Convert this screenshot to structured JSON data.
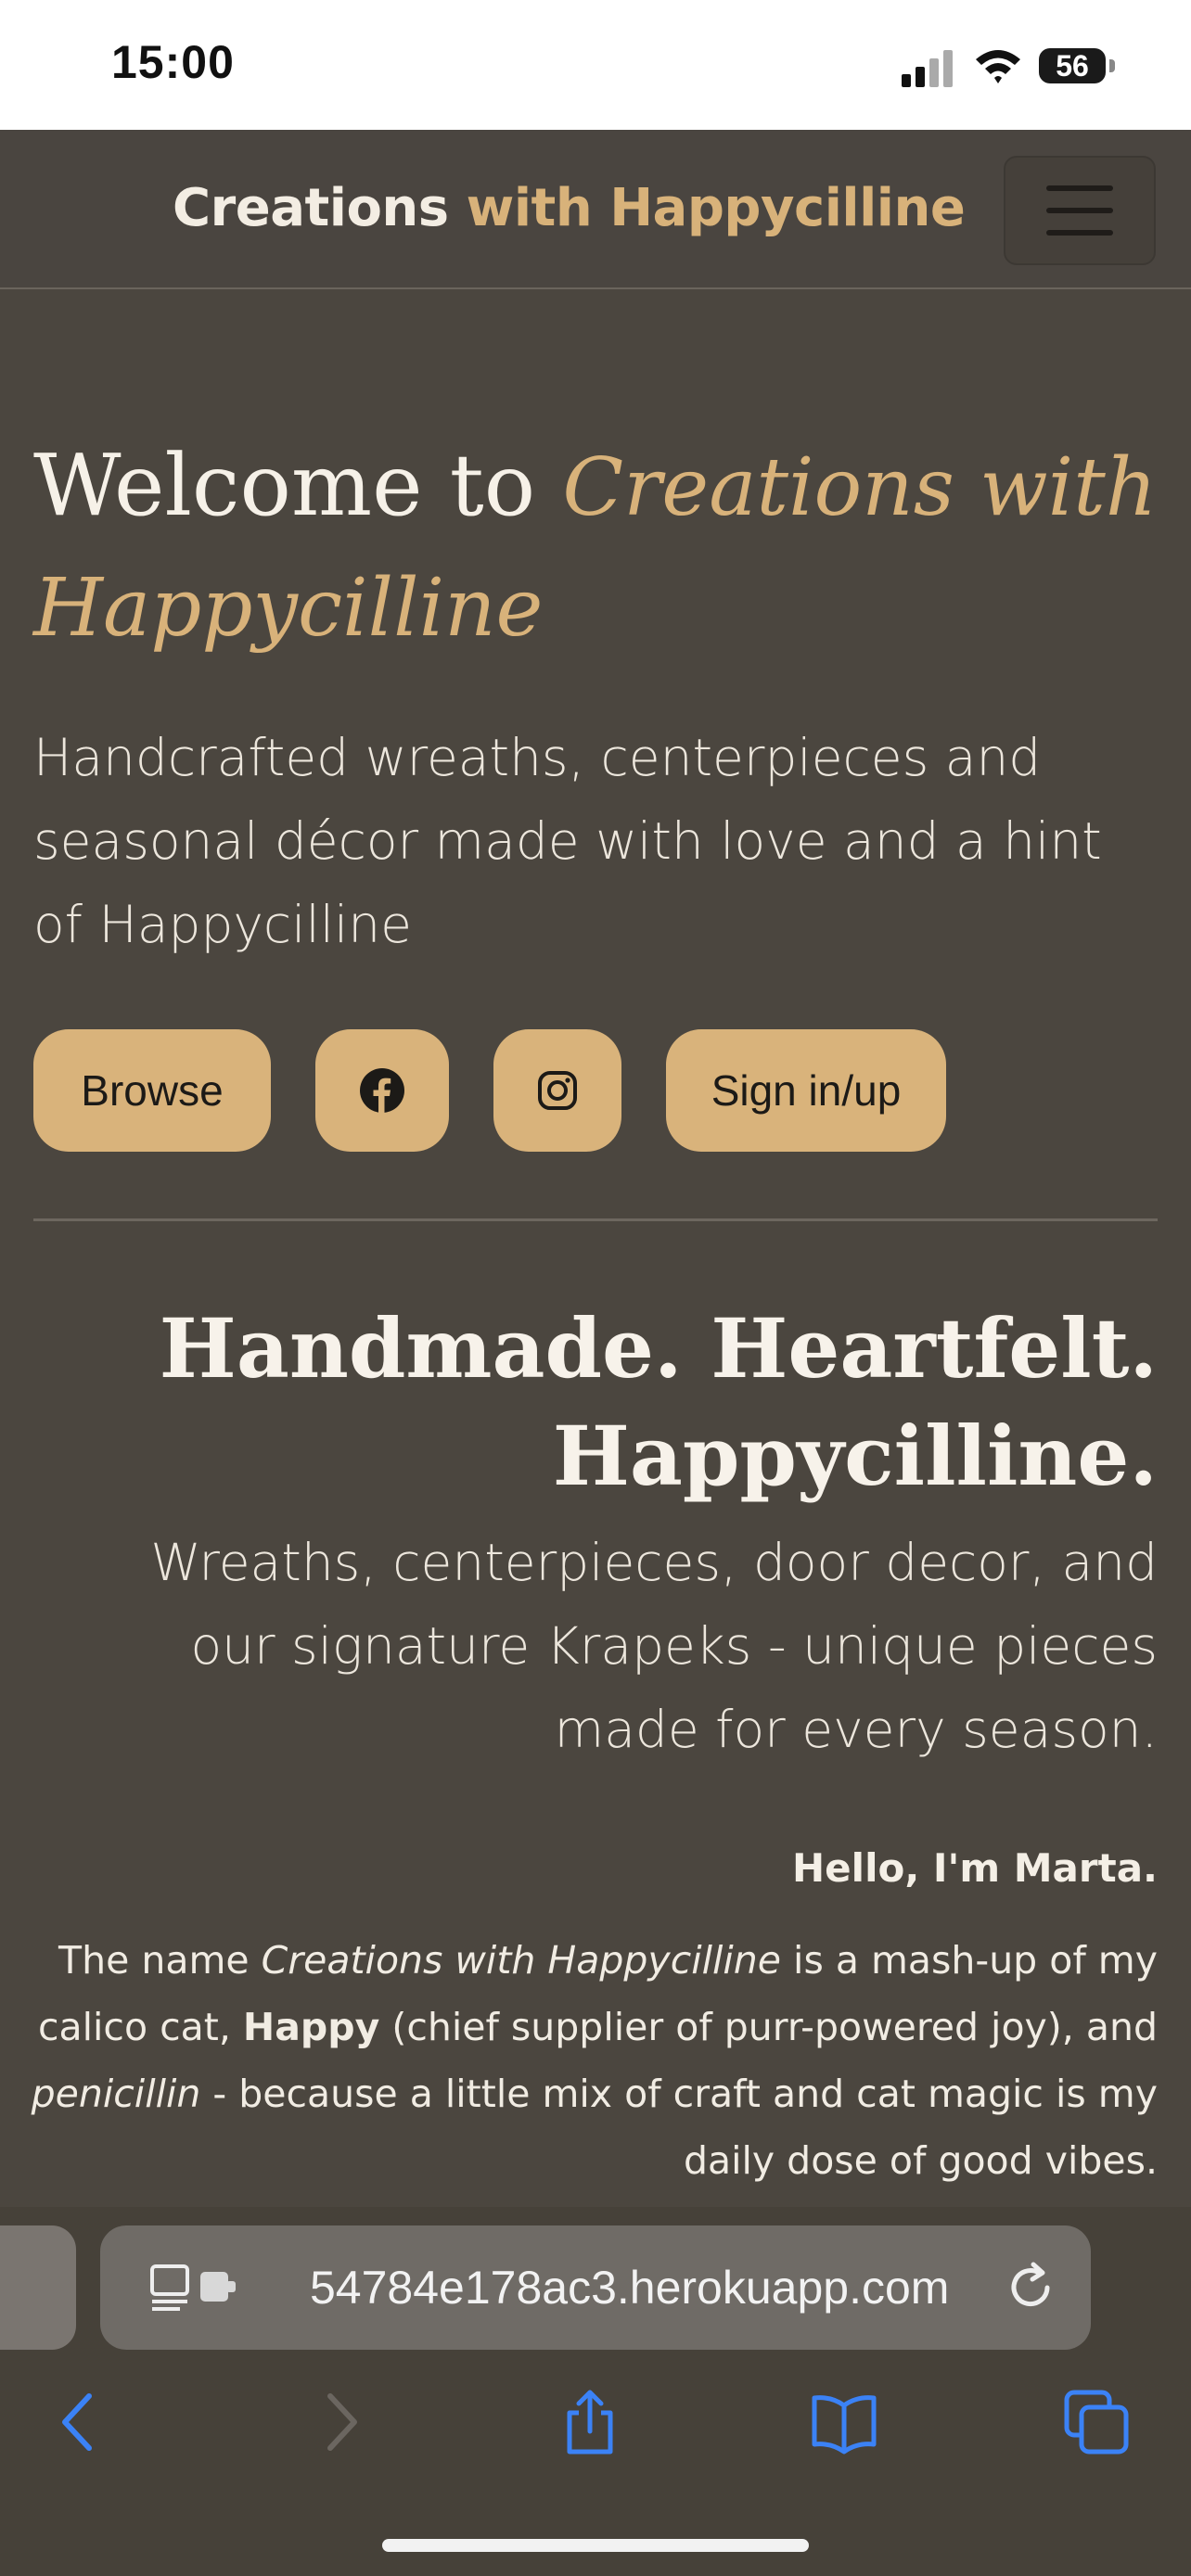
{
  "status_bar": {
    "time": "15:00",
    "battery_level": "56"
  },
  "navbar": {
    "brand_main": "Creations",
    "brand_accent": "with Happycilline",
    "menu_icon": "hamburger-icon"
  },
  "hero": {
    "title_plain": "Welcome to",
    "title_script_line1": "Creations with",
    "title_script_line2": "Happycilline",
    "subtitle": "Handcrafted wreaths, centerpieces and seasonal décor made with love and a hint of Happycilline",
    "buttons": {
      "browse": "Browse",
      "facebook_icon": "facebook-icon",
      "instagram_icon": "instagram-icon",
      "sign_in": "Sign in/up"
    }
  },
  "about": {
    "tagline_line1": "Handmade. Heartfelt.",
    "tagline_line2": "Happycilline.",
    "tagline_sub": "Wreaths, centerpieces, door decor, and our signature Krapeks - unique pieces made for every season.",
    "hello": "Hello, I'm Marta.",
    "text_1": "The name ",
    "text_name": "Creations with Happycilline",
    "text_2": " is a mash-up of my calico cat, ",
    "text_happy": "Happy",
    "text_3": " (chief supplier of purr-powered joy), and ",
    "text_penicillin": "penicillin",
    "text_4": " - because a little mix of craft and cat magic is my daily dose of good vibes."
  },
  "browser": {
    "url": "54784e178ac3.herokuapp.com",
    "icons": [
      "back-icon",
      "forward-icon",
      "share-icon",
      "bookmarks-icon",
      "tabs-icon",
      "reload-icon",
      "page-settings-icon"
    ]
  },
  "colors": {
    "background": "#4b463f",
    "accent": "#d8b27a",
    "button": "#d9b37b"
  }
}
